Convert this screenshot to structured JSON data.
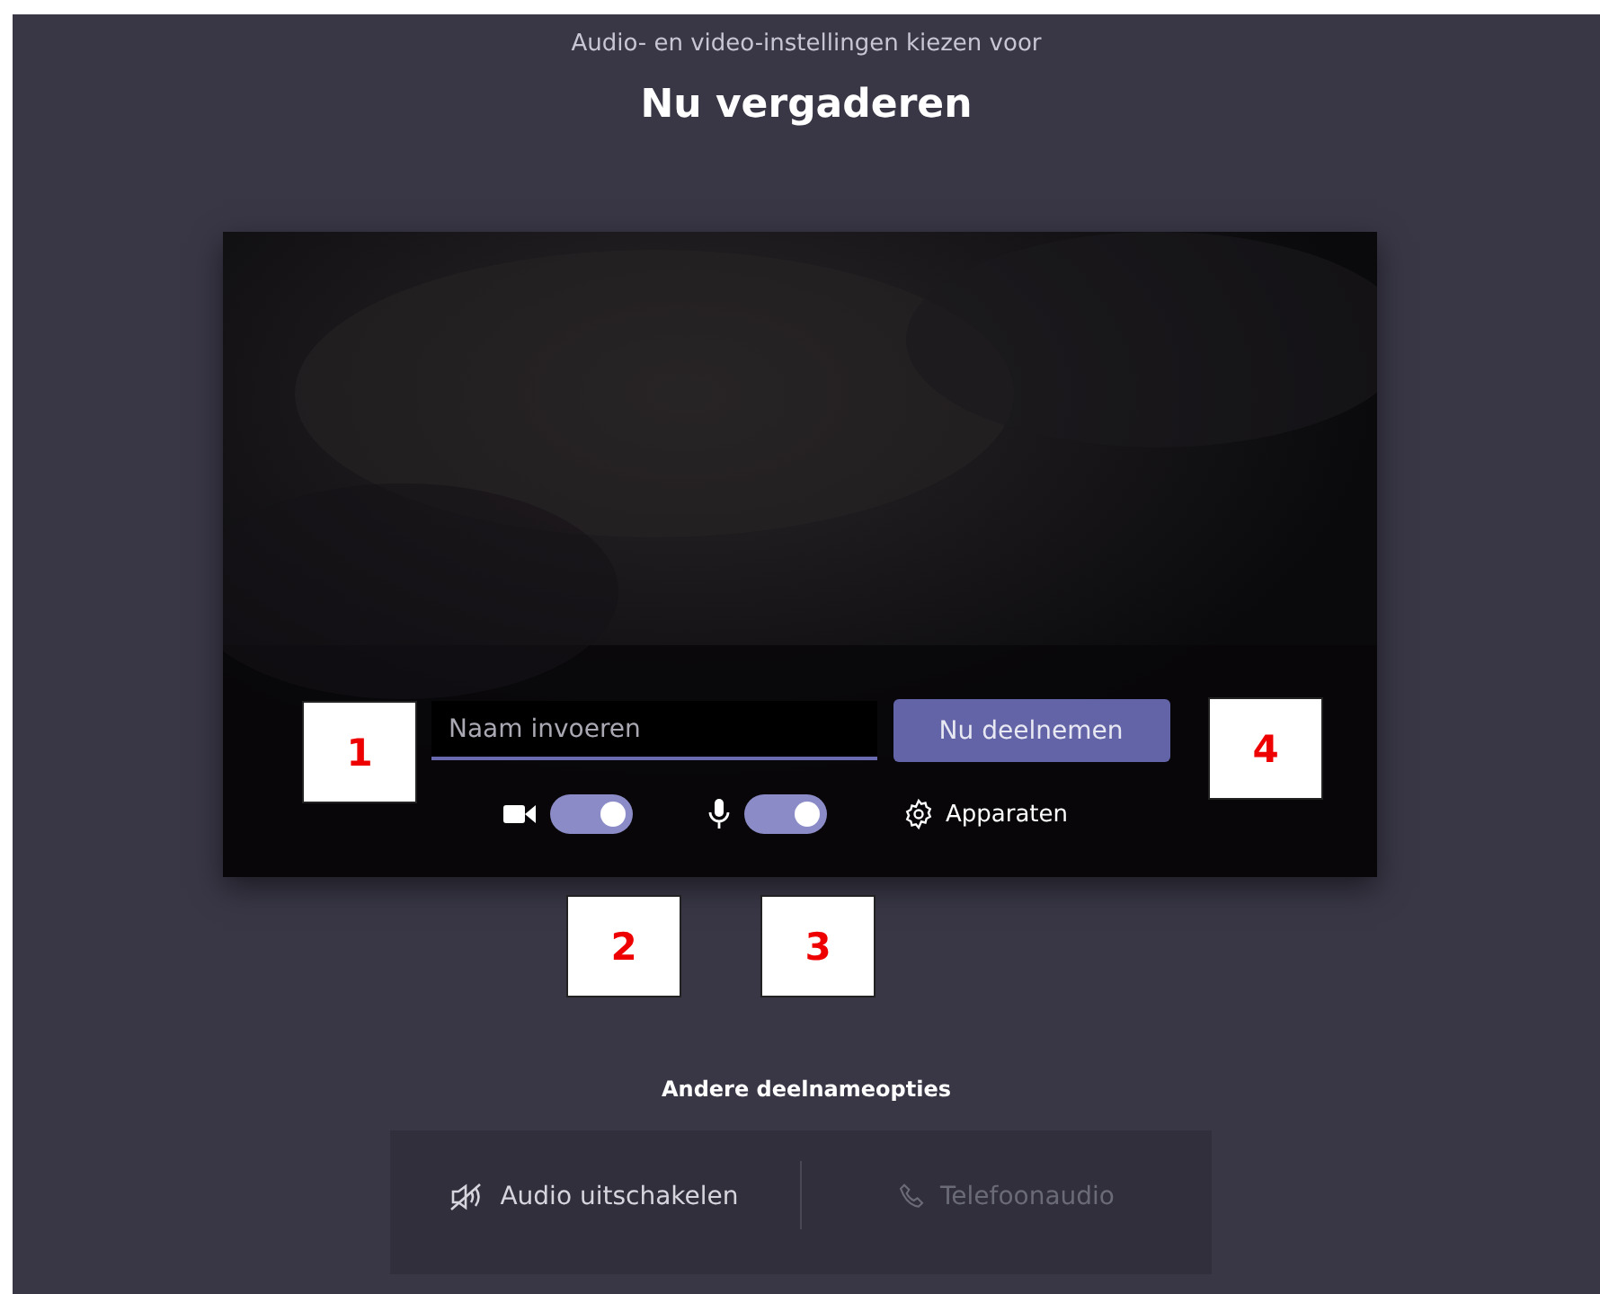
{
  "header": {
    "subtitle": "Audio- en video-instellingen kiezen voor",
    "title": "Nu vergaderen"
  },
  "name_field": {
    "placeholder": "Naam invoeren"
  },
  "join_button": "Nu deelnemen",
  "toggles": [
    {
      "kind": "camera",
      "on": true
    },
    {
      "kind": "microphone",
      "on": true
    }
  ],
  "devices_button": "Apparaten",
  "other_options": {
    "title": "Andere deelnameopties",
    "options": [
      {
        "kind": "audio-off",
        "label": "Audio uitschakelen",
        "disabled": false
      },
      {
        "kind": "phone",
        "label": "Telefoonaudio",
        "disabled": true
      }
    ]
  },
  "callouts": [
    {
      "label": "1"
    },
    {
      "label": "2"
    },
    {
      "label": "3"
    },
    {
      "label": "4"
    }
  ]
}
